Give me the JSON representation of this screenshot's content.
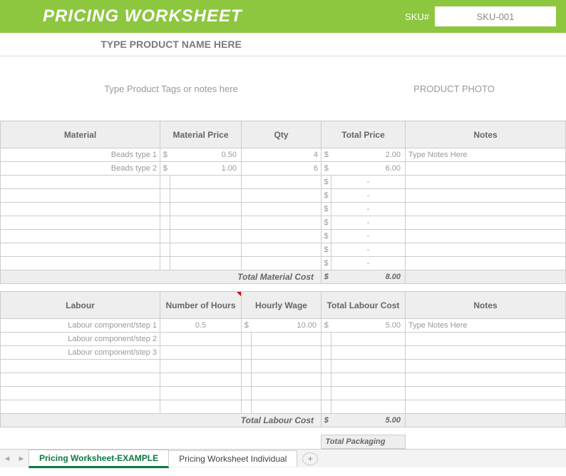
{
  "header": {
    "title": "PRICING WORKSHEET",
    "sku_label": "SKU#",
    "sku_value": "SKU-001"
  },
  "product": {
    "name_prompt": "TYPE PRODUCT NAME HERE",
    "tags_prompt": "Type Product Tags or notes here",
    "photo_label": "PRODUCT PHOTO"
  },
  "material_table": {
    "headers": {
      "material": "Material",
      "price": "Material Price",
      "qty": "Qty",
      "total": "Total Price",
      "notes": "Notes"
    },
    "rows": [
      {
        "material": "Beads type 1",
        "price": "0.50",
        "qty": "4",
        "total": "2.00",
        "notes": "Type Notes Here"
      },
      {
        "material": "Beads type 2",
        "price": "1.00",
        "qty": "6",
        "total": "6.00",
        "notes": ""
      }
    ],
    "empty_dash": "-",
    "total_label": "Total Material Cost",
    "total_value": "8.00"
  },
  "labour_table": {
    "headers": {
      "labour": "Labour",
      "hours": "Number of Hours",
      "wage": "Hourly Wage",
      "total": "Total Labour Cost",
      "notes": "Notes"
    },
    "rows": [
      {
        "labour": "Labour component/step 1",
        "hours": "0.5",
        "wage": "10.00",
        "total": "5.00",
        "notes": "Type Notes Here"
      },
      {
        "labour": "Labour component/step 2",
        "hours": "",
        "wage": "",
        "total": "",
        "notes": ""
      },
      {
        "labour": "Labour component/step 3",
        "hours": "",
        "wage": "",
        "total": "",
        "notes": ""
      }
    ],
    "total_label": "Total Labour Cost",
    "total_value": "5.00"
  },
  "packaging_label": "Total Packaging",
  "tabs": {
    "active": "Pricing Worksheet-EXAMPLE",
    "other": "Pricing Worksheet Individual"
  },
  "dollar": "$"
}
